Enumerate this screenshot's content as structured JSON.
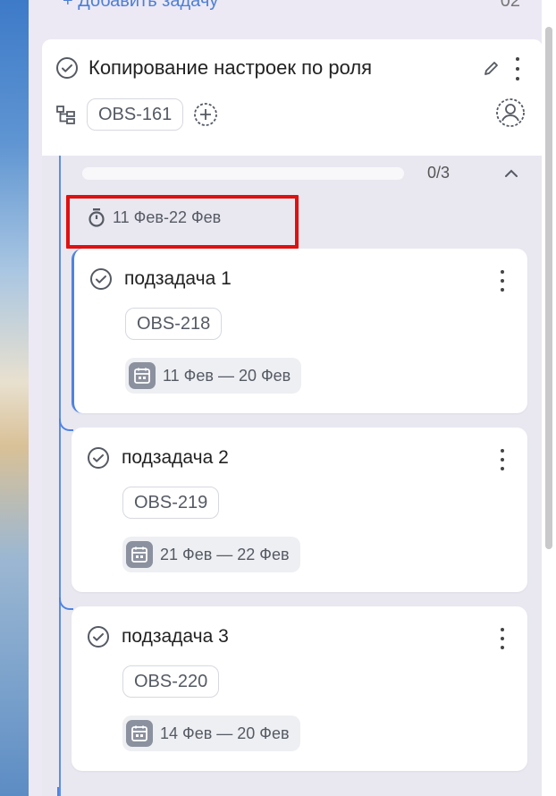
{
  "top_partial": {
    "text": "+ Добавить задачу",
    "count": "02"
  },
  "task": {
    "title": "Копирование настроек по роля",
    "code": "OBS-161"
  },
  "subtasks_header": {
    "progress": "0/3",
    "progress_fraction": 0,
    "date_range": "11 Фев-22 Фев"
  },
  "subtasks": [
    {
      "title": "подзадача 1",
      "code": "OBS-218",
      "dates": "11 Фев — 20 Фев"
    },
    {
      "title": "подзадача 2",
      "code": "OBS-219",
      "dates": "21 Фев — 22 Фев"
    },
    {
      "title": "подзадача 3",
      "code": "OBS-220",
      "dates": "14 Фев — 20 Фев"
    }
  ],
  "colors": {
    "accent": "#4f83e1",
    "highlight": "#e01010",
    "panel": "#e9e8f1"
  },
  "icons": [
    "check-circle-icon",
    "pencil-icon",
    "more-vertical-icon",
    "hierarchy-icon",
    "add-circle-icon",
    "assignee-icon",
    "chevron-up-icon",
    "timer-icon",
    "calendar-icon"
  ]
}
